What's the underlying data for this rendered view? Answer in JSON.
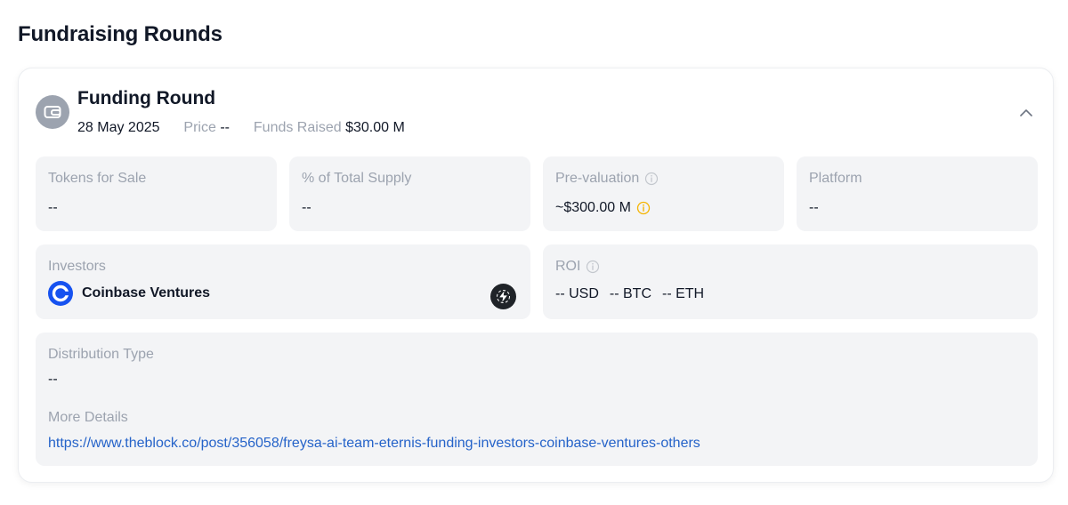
{
  "section": {
    "title": "Fundraising Rounds"
  },
  "round": {
    "title": "Funding Round",
    "date": "28 May 2025",
    "price_label": "Price",
    "price_value": "--",
    "funds_label": "Funds Raised",
    "funds_value": "$30.00 M",
    "collapse_icon": "chevron-up-icon",
    "round_icon": "wallet-icon"
  },
  "tiles": {
    "tokens_for_sale": {
      "label": "Tokens for Sale",
      "value": "--"
    },
    "total_supply": {
      "label": "% of Total Supply",
      "value": "--"
    },
    "pre_valuation": {
      "label": "Pre-valuation",
      "value": "~$300.00 M"
    },
    "platform": {
      "label": "Platform",
      "value": "--"
    }
  },
  "investors": {
    "label": "Investors",
    "items": [
      {
        "name": "Coinbase Ventures",
        "icon": "coinbase-logo-icon"
      }
    ],
    "badge_icon": "lightning-icon"
  },
  "roi": {
    "label": "ROI",
    "values": [
      "-- USD",
      "-- BTC",
      "-- ETH"
    ]
  },
  "distribution": {
    "label": "Distribution Type",
    "value": "--",
    "more_label": "More Details",
    "link": "https://www.theblock.co/post/356058/freysa-ai-team-eternis-funding-investors-coinbase-ventures-others"
  },
  "colors": {
    "link": "#2563c9",
    "muted": "#9ca3af",
    "tile_bg": "#f3f4f6",
    "warning": "#f5b400",
    "coinbase_blue": "#1652f0"
  }
}
